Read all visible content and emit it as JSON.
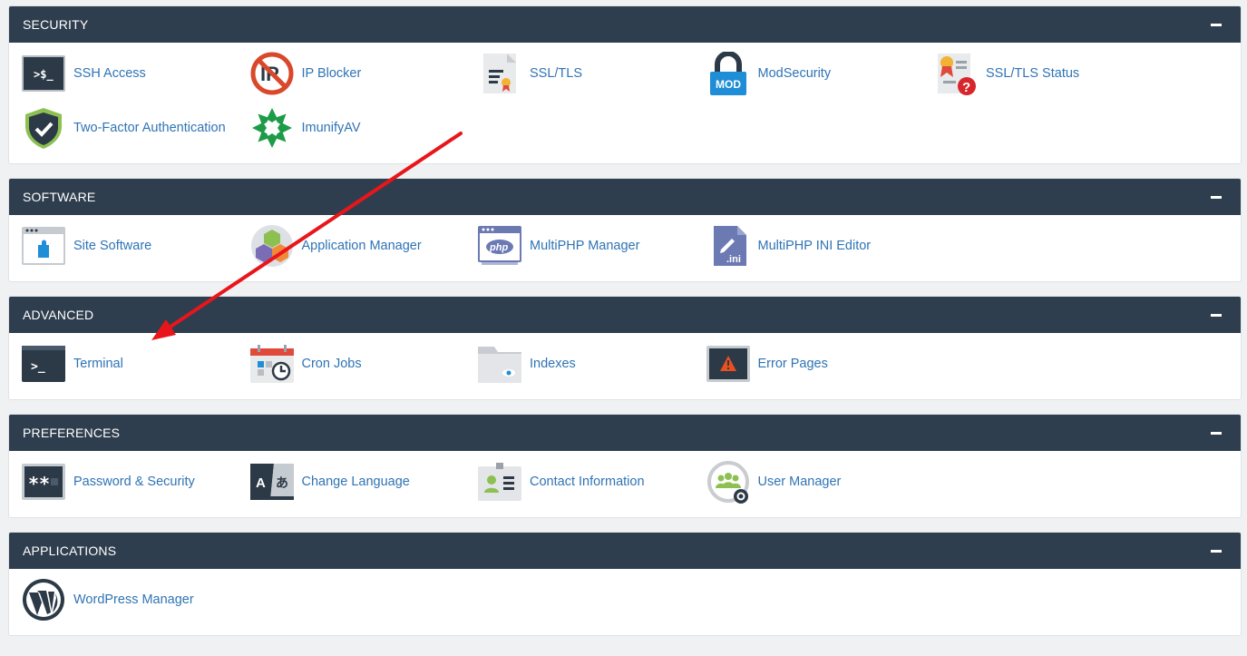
{
  "sections": [
    {
      "title": "SECURITY",
      "rows": [
        [
          {
            "label": "SSH Access",
            "icon": "terminal-ssh-icon"
          },
          {
            "label": "IP Blocker",
            "icon": "ip-blocker-icon"
          },
          {
            "label": "SSL/TLS",
            "icon": "certificate-icon"
          },
          {
            "label": "ModSecurity",
            "icon": "padlock-mod-icon"
          },
          {
            "label": "SSL/TLS Status",
            "icon": "certificate-status-icon"
          }
        ],
        [
          {
            "label": "Two-Factor Authentication",
            "icon": "shield-check-icon"
          },
          {
            "label": "ImunifyAV",
            "icon": "imunify-icon"
          }
        ]
      ]
    },
    {
      "title": "SOFTWARE",
      "rows": [
        [
          {
            "label": "Site Software",
            "icon": "puzzle-window-icon"
          },
          {
            "label": "Application Manager",
            "icon": "cubes-icon"
          },
          {
            "label": "MultiPHP Manager",
            "icon": "php-window-icon"
          },
          {
            "label": "MultiPHP INI Editor",
            "icon": "ini-file-icon"
          }
        ]
      ]
    },
    {
      "title": "ADVANCED",
      "rows": [
        [
          {
            "label": "Terminal",
            "icon": "terminal-icon"
          },
          {
            "label": "Cron Jobs",
            "icon": "calendar-clock-icon"
          },
          {
            "label": "Indexes",
            "icon": "folder-eye-icon"
          },
          {
            "label": "Error Pages",
            "icon": "warning-screen-icon"
          }
        ]
      ]
    },
    {
      "title": "PREFERENCES",
      "rows": [
        [
          {
            "label": "Password & Security",
            "icon": "password-icon"
          },
          {
            "label": "Change Language",
            "icon": "language-icon"
          },
          {
            "label": "Contact Information",
            "icon": "contact-card-icon"
          },
          {
            "label": "User Manager",
            "icon": "users-gear-icon"
          }
        ]
      ]
    },
    {
      "title": "APPLICATIONS",
      "rows": [
        [
          {
            "label": "WordPress Manager",
            "icon": "wordpress-icon"
          }
        ]
      ]
    }
  ],
  "icon_text": {
    "ssh": ">$_",
    "terminal": ">_",
    "mod": "MOD",
    "php": "php",
    "ini": ".ini",
    "password": "**",
    "lang_a": "A",
    "lang_b": "あ"
  },
  "colors": {
    "header_bg": "#2f3e4e",
    "link": "#2f74b5",
    "annotation_arrow": "#e8161b"
  }
}
